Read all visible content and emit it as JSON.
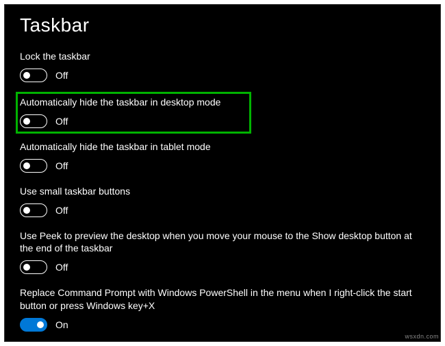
{
  "page": {
    "title": "Taskbar"
  },
  "settings": [
    {
      "label": "Lock the taskbar",
      "state": "Off",
      "on": false,
      "highlight": false
    },
    {
      "label": "Automatically hide the taskbar in desktop mode",
      "state": "Off",
      "on": false,
      "highlight": true
    },
    {
      "label": "Automatically hide the taskbar in tablet mode",
      "state": "Off",
      "on": false,
      "highlight": false
    },
    {
      "label": "Use small taskbar buttons",
      "state": "Off",
      "on": false,
      "highlight": false
    },
    {
      "label": "Use Peek to preview the desktop when you move your mouse to the Show desktop button at the end of the taskbar",
      "state": "Off",
      "on": false,
      "highlight": false
    },
    {
      "label": "Replace Command Prompt with Windows PowerShell in the menu when I right-click the start button or press Windows key+X",
      "state": "On",
      "on": true,
      "highlight": false
    }
  ],
  "watermark": "wsxdn.com"
}
